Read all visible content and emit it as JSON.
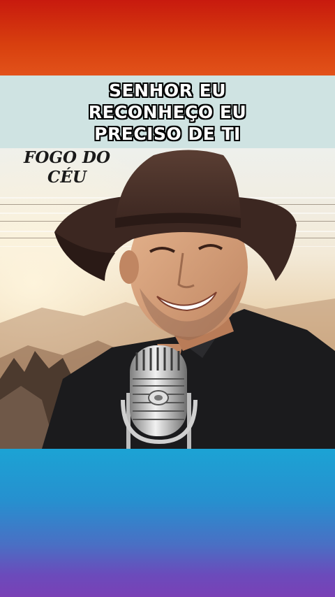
{
  "video": {
    "title_lines": [
      "SENHOR EU",
      "RECONHEÇO EU",
      "PRECISO DE TI"
    ],
    "watermark_lines": [
      "FOGO DO",
      "CÉU"
    ]
  },
  "colors": {
    "top_band": "#c81a0e",
    "title_band": "#cfe3e2",
    "bottom_band_top": "#1ca3d4",
    "bottom_band_bottom": "#7a40b6"
  }
}
